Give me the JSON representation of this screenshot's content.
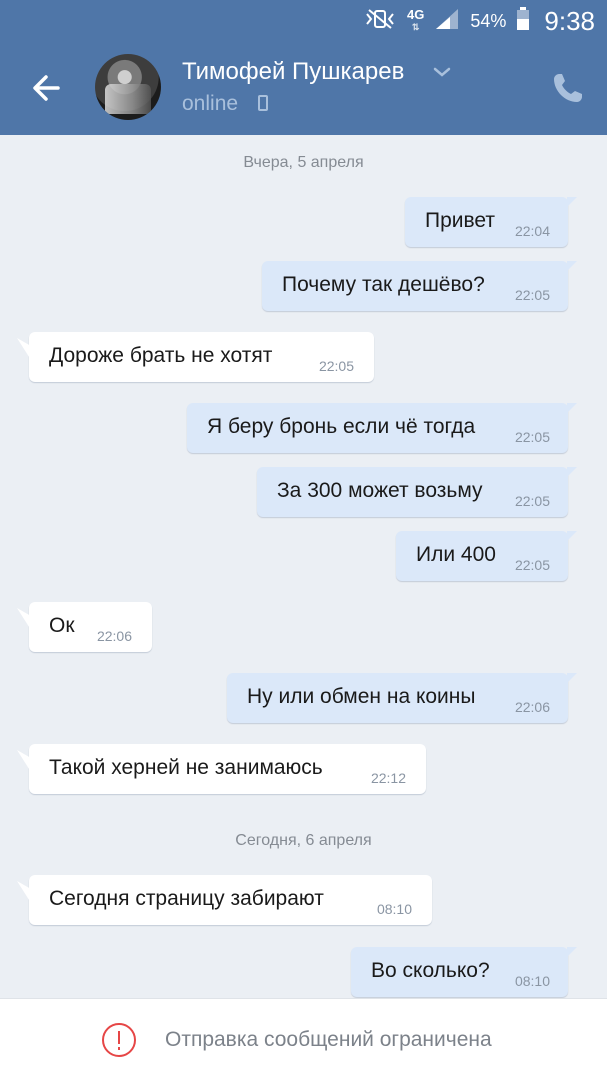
{
  "status_bar": {
    "network": "4G",
    "battery": "54%",
    "time": "9:38",
    "icons": [
      "mute-vibrate-icon",
      "signal-icon",
      "battery-icon"
    ]
  },
  "header": {
    "contact_name": "Тимофей Пушкарев",
    "status": "online",
    "icons": [
      "back-arrow-icon",
      "chevron-down-icon",
      "mobile-icon",
      "phone-icon"
    ]
  },
  "dates": {
    "yesterday": "Вчера, 5 апреля",
    "today": "Сегодня, 6 апреля"
  },
  "messages": [
    {
      "dir": "out",
      "text": "Привет",
      "time": "22:04"
    },
    {
      "dir": "out",
      "text": "Почему так дешёво?",
      "time": "22:05"
    },
    {
      "dir": "in",
      "text": "Дороже брать не хотят",
      "time": "22:05"
    },
    {
      "dir": "out",
      "text": "Я беру бронь если чё тогда",
      "time": "22:05"
    },
    {
      "dir": "out",
      "text": "За 300 может возьму",
      "time": "22:05"
    },
    {
      "dir": "out",
      "text": "Или 400",
      "time": "22:05"
    },
    {
      "dir": "in",
      "text": "Ок",
      "time": "22:06"
    },
    {
      "dir": "out",
      "text": "Ну или обмен на коины",
      "time": "22:06"
    },
    {
      "dir": "in",
      "text": "Такой херней не занимаюсь",
      "time": "22:12"
    },
    {
      "dir": "in",
      "text": "Сегодня страницу забирают",
      "time": "08:10"
    },
    {
      "dir": "out",
      "text": "Во сколько?",
      "time": "08:10"
    }
  ],
  "footer": {
    "notice": "Отправка сообщений ограничена",
    "icon": "warning-icon"
  },
  "colors": {
    "header_bg": "#4f76a8",
    "chat_bg": "#ebeff4",
    "outgoing_bubble": "#dbe8f9",
    "incoming_bubble": "#ffffff",
    "warning": "#e64646"
  }
}
